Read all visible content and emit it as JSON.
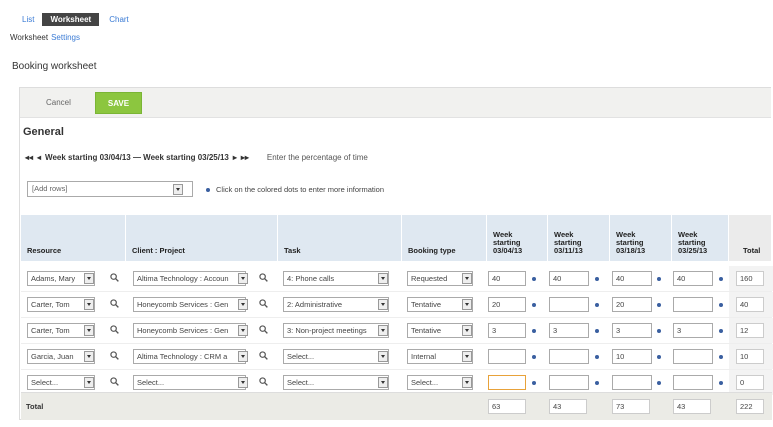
{
  "tabs": [
    {
      "label": "List",
      "active": false
    },
    {
      "label": "Worksheet",
      "active": true
    },
    {
      "label": "Chart",
      "active": false
    }
  ],
  "subnav": {
    "current": "Worksheet",
    "link": "Settings"
  },
  "page_title": "Booking worksheet",
  "toolbar": {
    "cancel": "Cancel",
    "save": "SAVE"
  },
  "section_title": "General",
  "weeknav": {
    "first": "◂◂",
    "prev": "◂",
    "range": "Week starting 03/04/13 — Week starting 03/25/13",
    "next": "▸",
    "last": "▸▸",
    "hint": "Enter the percentage of time"
  },
  "add_rows": {
    "value": "[Add rows]",
    "hint": "Click on the colored dots to enter more information"
  },
  "columns": {
    "resource": "Resource",
    "client_project": "Client : Project",
    "task": "Task",
    "booking_type": "Booking type",
    "week1": [
      "Week",
      "starting",
      "03/04/13"
    ],
    "week2": [
      "Week",
      "starting",
      "03/11/13"
    ],
    "week3": [
      "Week",
      "starting",
      "03/18/13"
    ],
    "week4": [
      "Week",
      "starting",
      "03/25/13"
    ],
    "total": "Total"
  },
  "rows": [
    {
      "resource": "Adams, Mary",
      "project": "Altima Technology : Accoun",
      "task": "4: Phone calls",
      "type": "Requested",
      "w1": "40",
      "w2": "40",
      "w3": "40",
      "w4": "40",
      "total": "160"
    },
    {
      "resource": "Carter, Tom",
      "project": "Honeycomb Services : Gen",
      "task": "2: Administrative",
      "type": "Tentative",
      "w1": "20",
      "w2": "",
      "w3": "20",
      "w4": "",
      "total": "40"
    },
    {
      "resource": "Carter, Tom",
      "project": "Honeycomb Services : Gen",
      "task": "3: Non-project meetings",
      "type": "Tentative",
      "w1": "3",
      "w2": "3",
      "w3": "3",
      "w4": "3",
      "total": "12"
    },
    {
      "resource": "Garcia, Juan",
      "project": "Altima Technology : CRM a",
      "task": "Select...",
      "type": "Internal",
      "w1": "",
      "w2": "",
      "w3": "10",
      "w4": "",
      "total": "10"
    },
    {
      "resource": "Select...",
      "project": "Select...",
      "task": "Select...",
      "type": "Select...",
      "w1": "",
      "w2": "",
      "w3": "",
      "w4": "",
      "total": "0"
    }
  ],
  "totals": {
    "label": "Total",
    "w1": "63",
    "w2": "43",
    "w3": "73",
    "w4": "43",
    "total": "222"
  }
}
